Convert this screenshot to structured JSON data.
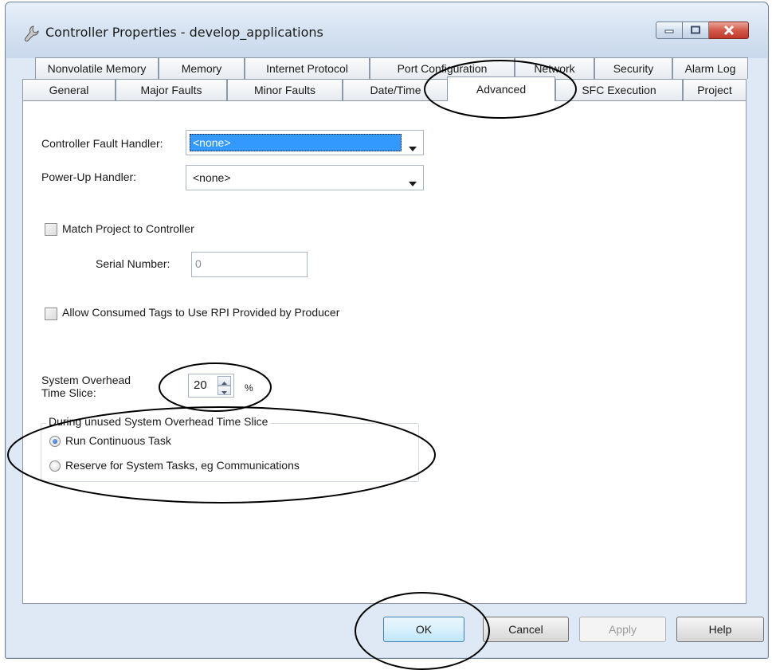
{
  "window": {
    "title": "Controller Properties - develop_applications",
    "app_icon": "wrench-icon",
    "controls": [
      "minimize-icon",
      "maximize-icon",
      "close-icon"
    ]
  },
  "tabs": {
    "row1": [
      "Nonvolatile Memory",
      "Memory",
      "Internet Protocol",
      "Port Configuration",
      "Network",
      "Security",
      "Alarm Log"
    ],
    "row2": [
      "General",
      "Major Faults",
      "Minor Faults",
      "Date/Time",
      "Advanced",
      "SFC Execution",
      "Project"
    ],
    "active": "Advanced"
  },
  "form": {
    "fault_handler_label": "Controller Fault Handler:",
    "fault_handler_value": "<none>",
    "powerup_label": "Power-Up Handler:",
    "powerup_value": "<none>",
    "match_project_label": "Match Project to Controller",
    "match_project_checked": false,
    "serial_label": "Serial Number:",
    "serial_value": "0",
    "allow_consumed_label": "Allow Consumed Tags to Use RPI Provided by Producer",
    "allow_consumed_checked": false,
    "overhead_label_1": "System Overhead",
    "overhead_label_2": "Time Slice:",
    "overhead_value": "20",
    "overhead_unit": "%",
    "group_title": "During unused System Overhead Time Slice",
    "radio_run": "Run Continuous Task",
    "radio_reserve": "Reserve for System Tasks, eg Communications",
    "selected_option": "Run Continuous Task"
  },
  "buttons": {
    "ok": "OK",
    "cancel": "Cancel",
    "apply": "Apply",
    "help": "Help"
  },
  "colors": {
    "selection": "#3399ff",
    "window_frame": "#dfe9f5",
    "close_button": "#c0392b"
  }
}
